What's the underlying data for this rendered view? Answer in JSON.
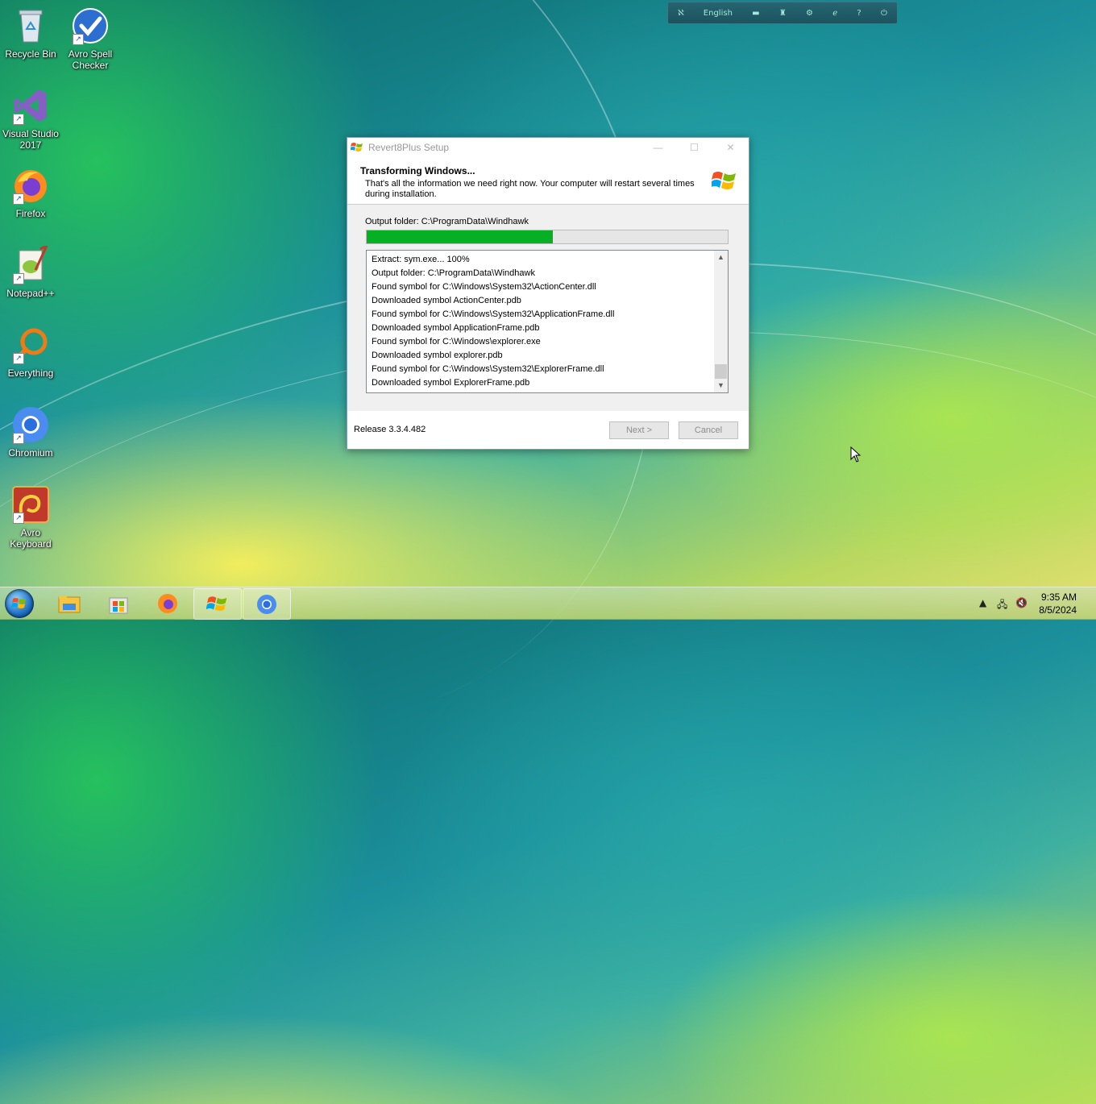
{
  "desktop": {
    "icons": [
      {
        "label": "Recycle Bin",
        "icon": "recycle-bin-icon"
      },
      {
        "label": "Avro Spell Checker",
        "icon": "avro-spell-checker-icon"
      },
      {
        "label": "Visual Studio 2017",
        "icon": "visual-studio-icon"
      },
      {
        "label": "Firefox",
        "icon": "firefox-icon"
      },
      {
        "label": "Notepad++",
        "icon": "notepad-plus-plus-icon"
      },
      {
        "label": "Everything",
        "icon": "everything-search-icon"
      },
      {
        "label": "Chromium",
        "icon": "chromium-icon"
      },
      {
        "label": "Avro Keyboard",
        "icon": "avro-keyboard-icon"
      }
    ]
  },
  "language_bar": {
    "language": "English"
  },
  "dialog": {
    "title": "Revert8Plus Setup",
    "header_title": "Transforming Windows...",
    "header_subtitle": "That's all the information we need right now. Your computer will restart several times during installation.",
    "output_folder": "Output folder: C:\\ProgramData\\Windhawk",
    "progress_fraction": 0.515,
    "log_lines": [
      "Extract: sym.exe... 100%",
      "Output folder: C:\\ProgramData\\Windhawk",
      "Found symbol for C:\\Windows\\System32\\ActionCenter.dll",
      "Downloaded symbol ActionCenter.pdb",
      "Found symbol for C:\\Windows\\System32\\ApplicationFrame.dll",
      "Downloaded symbol ApplicationFrame.pdb",
      "Found symbol for C:\\Windows\\explorer.exe",
      "Downloaded symbol explorer.pdb",
      "Found symbol for C:\\Windows\\System32\\ExplorerFrame.dll",
      "Downloaded symbol ExplorerFrame.pdb"
    ],
    "release": "Release 3.3.4.482",
    "next_label": "Next >",
    "cancel_label": "Cancel",
    "minimize_symbol": "—",
    "maximize_symbol": "☐",
    "close_symbol": "✕"
  },
  "taskbar": {
    "items": [
      "file-explorer-icon",
      "store-icon",
      "firefox-icon",
      "revert8plus-setup-icon",
      "chromium-icon"
    ],
    "time": "9:35 AM",
    "date": "8/5/2024"
  },
  "colors": {
    "progress": "#06b025",
    "accent": "#1b6bbf"
  }
}
